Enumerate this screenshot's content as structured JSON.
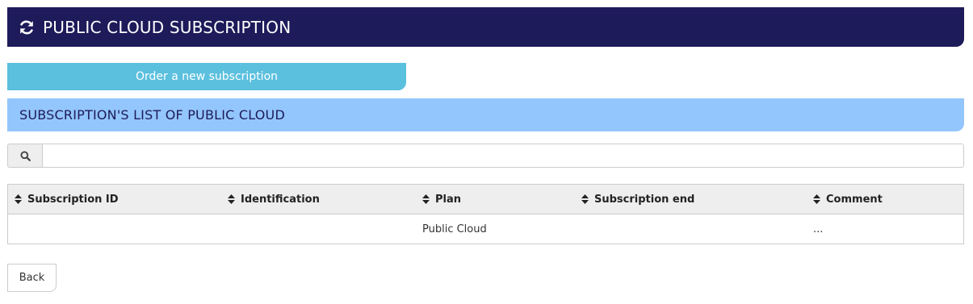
{
  "header": {
    "icon": "refresh-icon",
    "title": "PUBLIC CLOUD SUBSCRIPTION"
  },
  "order_button": {
    "label": "Order a new subscription"
  },
  "section": {
    "title": "SUBSCRIPTION'S LIST OF PUBLIC CLOUD"
  },
  "search": {
    "icon": "search-icon",
    "value": "",
    "placeholder": ""
  },
  "table": {
    "columns": [
      {
        "label": "Subscription ID",
        "icon": "sort-icon"
      },
      {
        "label": "Identification",
        "icon": "sort-icon"
      },
      {
        "label": "Plan",
        "icon": "sort-icon"
      },
      {
        "label": "Subscription end",
        "icon": "sort-icon"
      },
      {
        "label": "Comment",
        "icon": "sort-icon"
      }
    ],
    "rows": [
      {
        "subscription_id": "",
        "identification": "",
        "plan": "Public Cloud",
        "subscription_end": "",
        "comment": "..."
      }
    ]
  },
  "back_button": {
    "label": "Back"
  },
  "colors": {
    "header_bg": "#1e1b5a",
    "order_button_bg": "#5bc0de",
    "section_bg": "#93c6fc"
  }
}
